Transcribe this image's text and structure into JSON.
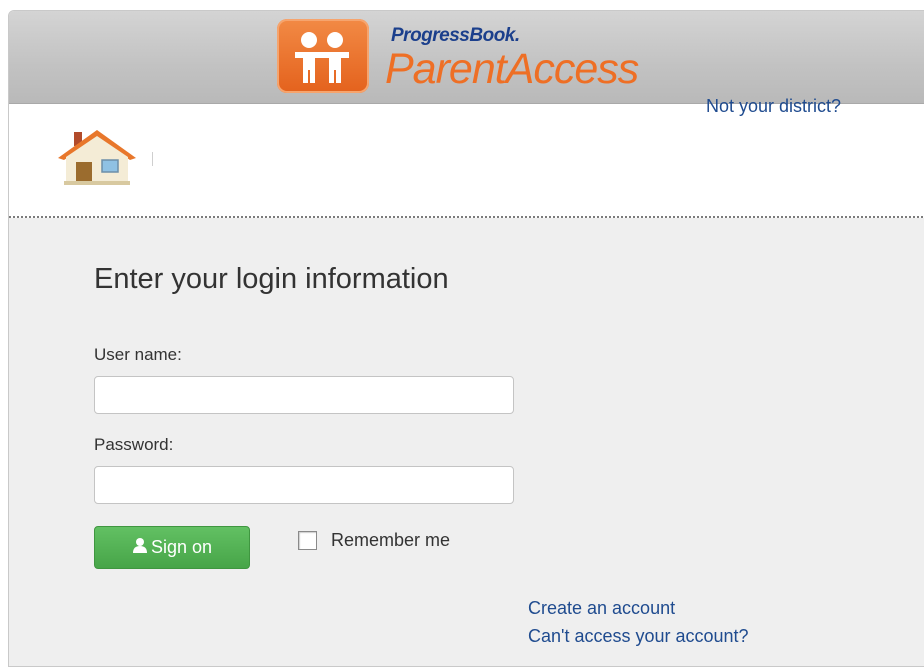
{
  "header": {
    "brand_small": "ProgressBook.",
    "brand_big": "ParentAccess",
    "logo_icon": "family-icon",
    "not_your_district": "Not your district?"
  },
  "home": {
    "icon": "home-icon"
  },
  "login": {
    "heading": "Enter your login information",
    "username_label": "User name:",
    "username_value": "",
    "password_label": "Password:",
    "password_value": "",
    "sign_on_label": "Sign on",
    "sign_on_icon": "user-icon",
    "remember_label": "Remember me",
    "remember_checked": false
  },
  "links": {
    "create_account": "Create an account",
    "cant_access": "Can't access your account?"
  },
  "colors": {
    "brand_orange": "#ee6f25",
    "brand_blue": "#1b3f8c",
    "link_blue": "#1f4b8f",
    "button_green": "#4cae4c"
  }
}
